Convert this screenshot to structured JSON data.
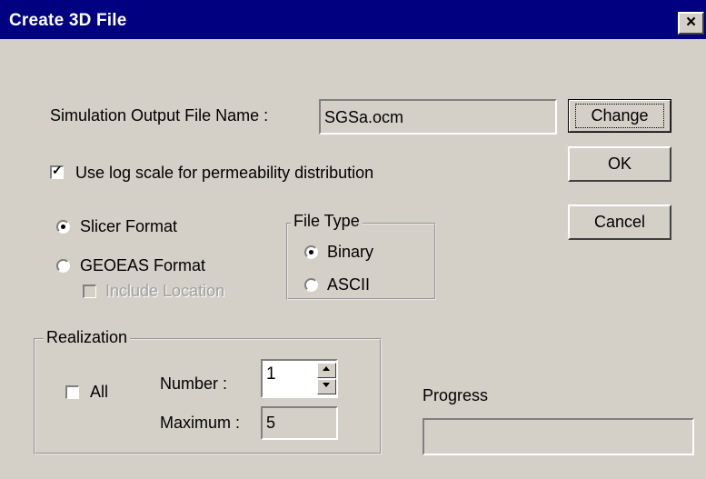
{
  "window": {
    "title": "Create 3D File",
    "close_label": "×"
  },
  "output_file": {
    "label": "Simulation Output File Name :",
    "value": "SGSa.ocm"
  },
  "buttons": {
    "change": "Change",
    "ok": "OK",
    "cancel": "Cancel"
  },
  "log_scale": {
    "label": "Use log scale for permeability distribution",
    "checked": true
  },
  "format": {
    "slicer": "Slicer Format",
    "geoeas": "GEOEAS Format",
    "include_location": "Include Location",
    "selected": "slicer"
  },
  "file_type": {
    "title": "File Type",
    "binary": "Binary",
    "ascii": "ASCII",
    "selected": "binary"
  },
  "realization": {
    "title": "Realization",
    "all_label": "All",
    "all_checked": false,
    "number_label": "Number :",
    "number_value": "1",
    "maximum_label": "Maximum :",
    "maximum_value": "5"
  },
  "progress": {
    "label": "Progress",
    "value": 0
  }
}
